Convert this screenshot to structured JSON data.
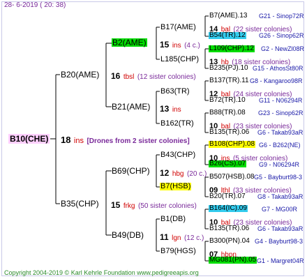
{
  "date": "28-  6-2019 (  20:  38)",
  "root": {
    "name": "B10(CHE)",
    "num": "18",
    "breed": "ins",
    "note": "[Drones from 2 sister colonies]"
  },
  "gen1": [
    {
      "name": "B20(AME)",
      "num": "16",
      "breed": "tbsl",
      "note": "(12 sister colonies)"
    },
    {
      "name": "B35(CHP)",
      "num": "15",
      "breed": "frkg",
      "note": "(50 sister colonies)"
    }
  ],
  "gen2": [
    {
      "name": "B2(AME)",
      "num": "15",
      "breed": "ins",
      "note": "(4 c.)"
    },
    {
      "name": "B21(AME)",
      "num": "13",
      "breed": "ins",
      "note": ""
    },
    {
      "name": "B69(CHP)",
      "num": "12",
      "breed": "hbg",
      "note": "(20 c.)"
    },
    {
      "name": "B49(DB)",
      "num": "11",
      "breed": "lgn",
      "note": "(12 c.)"
    }
  ],
  "gen3": [
    {
      "name": "B17(AME)"
    },
    {
      "name": "L185(CHP)"
    },
    {
      "name": "B63(TR)"
    },
    {
      "name": "B162(TR)"
    },
    {
      "name": "B43(CHP)"
    },
    {
      "name": "B7(HSB)"
    },
    {
      "name": "B1(DB)"
    },
    {
      "name": "B79(HGS)"
    }
  ],
  "gen4": [
    {
      "name": "B7(AME).13",
      "ref": "G21 - Sinop72R"
    },
    {
      "num": "14",
      "breed": "bal",
      "note": "(22 sister colonies)"
    },
    {
      "name": "B54(TR).12",
      "ref": "G26 - Sinop62R"
    },
    {
      "name": "L109(CHP).12",
      "ref": "G2 - NewZl08R"
    },
    {
      "num": "13",
      "breed": "hb",
      "note": "(18 sister colonies)"
    },
    {
      "name": "B235(PJ).10",
      "ref": "G15 - AthosSt80R"
    },
    {
      "name": "B137(TR).11",
      "ref": "G8 - Kangaroo98R"
    },
    {
      "num": "12",
      "breed": "bal",
      "note": "(24 sister colonies)"
    },
    {
      "name": "B72(TR).10",
      "ref": "G11 - N06294R"
    },
    {
      "name": "B88(TR).08",
      "ref": "G23 - Sinop62R"
    },
    {
      "num": "10",
      "breed": "bal",
      "note": "(23 sister colonies)"
    },
    {
      "name": "B135(TR).06",
      "ref": "G6 - Takab93aR"
    },
    {
      "name": "B108(CHP).08",
      "ref": "G6 - B262(NE)"
    },
    {
      "num": "10",
      "breed": "ins",
      "note": "(5 sister colonies)"
    },
    {
      "name": "B26(CS).07",
      "ref": "G9 - N06294R"
    },
    {
      "name": "B507(HSB).08",
      "ref": "G5 - Bayburt98-3"
    },
    {
      "num": "09",
      "breed": "lthl",
      "note": "(33 sister colonies)"
    },
    {
      "name": "B20(TR).07",
      "ref": "G8 - Takab93aR"
    },
    {
      "name": "B164(IC).09",
      "ref": "G7 - MG00R"
    },
    {
      "num": "10",
      "breed": "bal",
      "note": "(23 sister colonies)"
    },
    {
      "name": "B135(TR).06",
      "ref": "G6 - Takab93aR"
    },
    {
      "name": "B300(PN).04",
      "ref": "G4 - Bayburt98-3"
    },
    {
      "num": "07",
      "breed": "hbpn",
      "note": ""
    },
    {
      "name": "MG081(PN).05",
      "ref": "G1 - Margret04R"
    }
  ],
  "footer": "Copyright 2004-2019 © Karl Kehrle Foundation    www.pedigreeapis.org",
  "colors": {
    "highlight_green": "#00dd00",
    "highlight_cyan": "#33ccee",
    "highlight_yellow": "#ffff00",
    "root_bg": "#ffd0ff",
    "lines": "#000000"
  }
}
